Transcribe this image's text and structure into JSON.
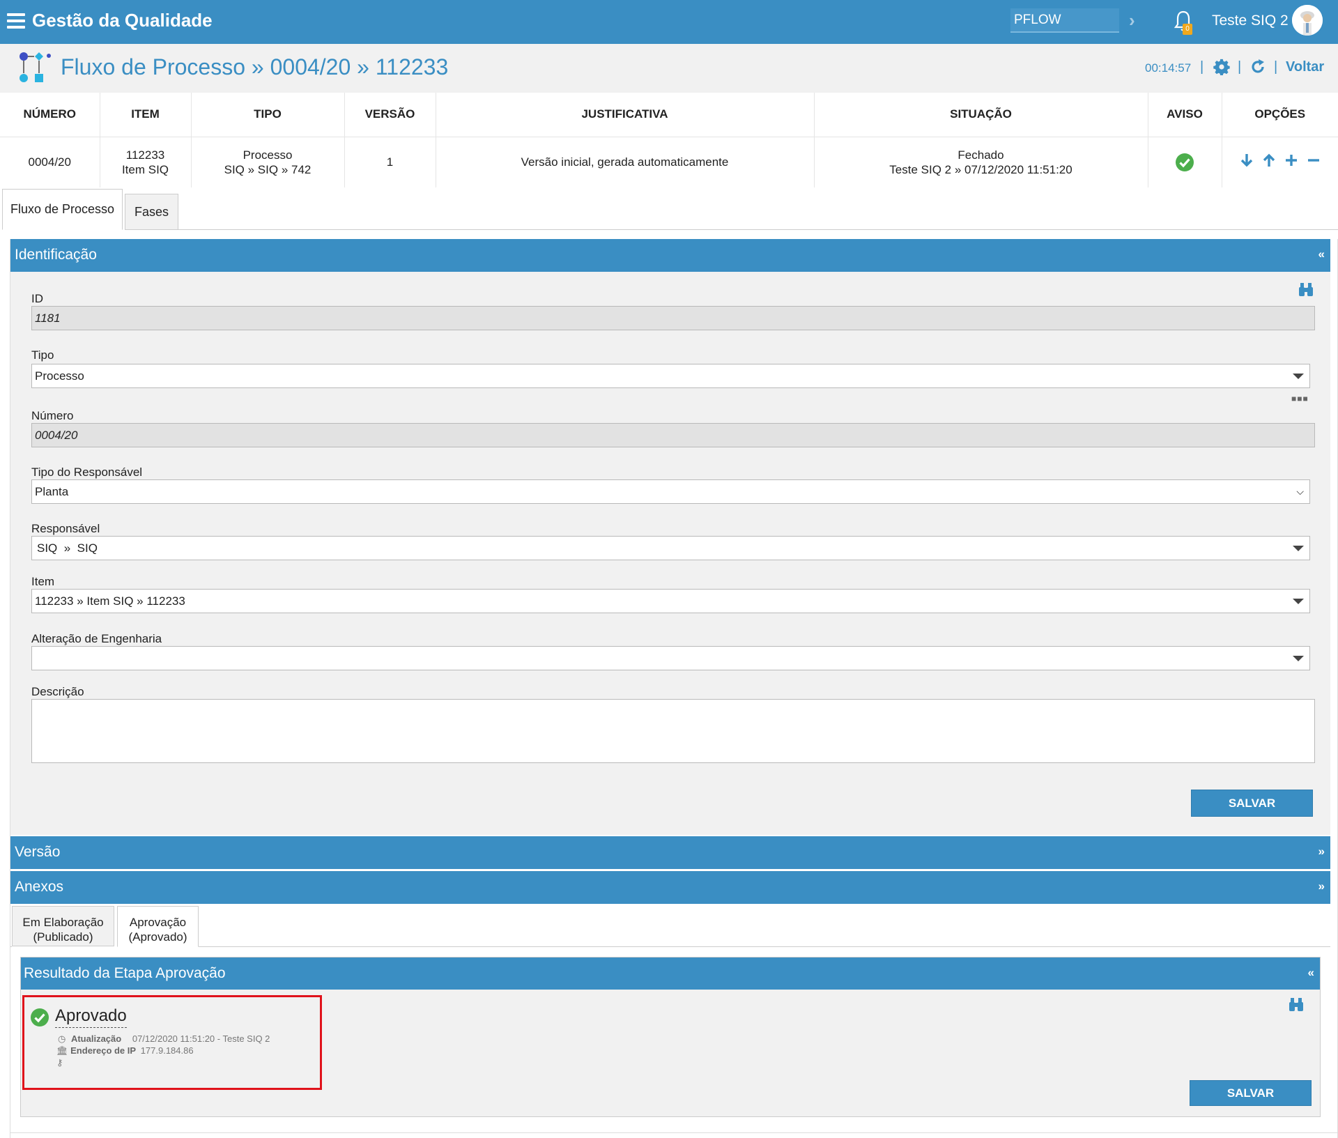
{
  "topbar": {
    "app_title": "Gestão da Qualidade",
    "module_value": "PFLOW",
    "notification_count": "0",
    "user_name": "Teste SIQ 2"
  },
  "header": {
    "title": "Fluxo de Processo » 0004/20 » 112233",
    "timer": "00:14:57",
    "separator": "|",
    "back_label": "Voltar"
  },
  "summary": {
    "headers": [
      "NÚMERO",
      "ITEM",
      "TIPO",
      "VERSÃO",
      "JUSTIFICATIVA",
      "SITUAÇÃO",
      "AVISO",
      "OPÇÕES"
    ],
    "numero": "0004/20",
    "item_line1": "112233",
    "item_line2": "Item SIQ",
    "tipo_line1": "Processo",
    "tipo_line2": "SIQ » SIQ » 742",
    "versao": "1",
    "justificativa": "Versão inicial, gerada automaticamente",
    "situacao_line1": "Fechado",
    "situacao_line2": "Teste SIQ 2 » 07/12/2020 11:51:20"
  },
  "tabs": {
    "fluxo": "Fluxo de Processo",
    "fases": "Fases"
  },
  "identificacao": {
    "title": "Identificação",
    "collapse_symbol": "«",
    "id_label": "ID",
    "id_value": "1181",
    "tipo_label": "Tipo",
    "tipo_value": "Processo",
    "numero_label": "Número",
    "numero_value": "0004/20",
    "tipo_resp_label": "Tipo do Responsável",
    "tipo_resp_value": "Planta",
    "responsavel_label": "Responsável",
    "responsavel_value": "SIQ  »  SIQ",
    "item_label": "Item",
    "item_value": "112233 » Item SIQ » 112233",
    "alteracao_label": "Alteração de Engenharia",
    "alteracao_value": "",
    "descricao_label": "Descrição",
    "save_label": "SALVAR"
  },
  "versao_section": {
    "title": "Versão",
    "expand_symbol": "»"
  },
  "anexos_section": {
    "title": "Anexos",
    "expand_symbol": "»"
  },
  "subtabs": {
    "elaboracao_line1": "Em Elaboração",
    "elaboracao_line2": "(Publicado)",
    "aprovacao_line1": "Aprovação",
    "aprovacao_line2": "(Aprovado)"
  },
  "resultado": {
    "title": "Resultado da Etapa Aprovação",
    "collapse_symbol": "«",
    "status": "Aprovado",
    "atualizacao_label": "Atualização",
    "atualizacao_value": "07/12/2020 11:51:20 - Teste SIQ 2",
    "ip_label": "Endereço de IP",
    "ip_value": "177.9.184.86",
    "save_label": "SALVAR"
  },
  "colors": {
    "primary": "#3a8ec3",
    "success": "#4cae4c",
    "highlight": "#e0121b",
    "badge": "#f0a81e"
  },
  "icons": [
    "menu-icon",
    "chevron-right-icon",
    "bell-icon",
    "avatar",
    "flow-icon",
    "gear-icon",
    "refresh-icon",
    "check-circle-icon",
    "arrow-down-icon",
    "arrow-up-icon",
    "plus-icon",
    "minus-icon",
    "binoculars-icon",
    "dots-icon",
    "clock-icon",
    "bank-icon",
    "key-icon"
  ]
}
